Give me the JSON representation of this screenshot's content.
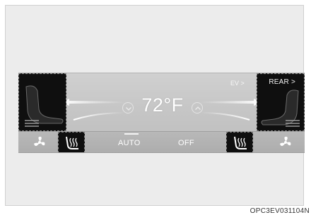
{
  "panel": {
    "ev_label": "EV >",
    "rear_label": "REAR >",
    "temperature": "72°F"
  },
  "bottom_bar": {
    "auto_label": "AUTO",
    "off_label": "OFF"
  },
  "caption": "OPC3EV031104N",
  "colors": {
    "panel_bg": "#c6c6c6",
    "dark_tile": "#0f0f0f",
    "text": "#ffffff"
  },
  "icons": [
    "seat-icon",
    "chevron-down-icon",
    "chevron-up-icon",
    "fan-icon",
    "seat-heat-icon"
  ]
}
